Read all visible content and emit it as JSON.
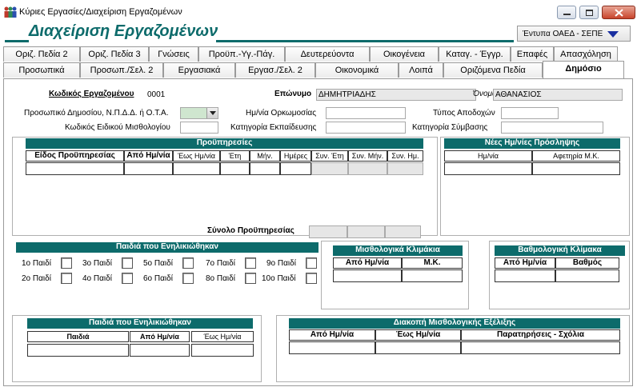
{
  "window": {
    "title": "Κύριες Εργασίες/Διαχείριση Εργαζομένων",
    "heading": "Διαχείριση Εργαζομένων",
    "print_select": "Έντυπα ΟΑΕΔ - ΣΕΠΕ"
  },
  "tabs_row1": [
    "Οριζ. Πεδία 2",
    "Οριζ. Πεδία 3",
    "Γνώσεις",
    "Προϋπ.-Υγ.-Πάγ.",
    "Δευτερεύοντα",
    "Οικογένεια",
    "Καταγ. - Έγγρ.",
    "Επαφές",
    "Απασχόληση"
  ],
  "tabs_row2": [
    "Προσωπικά",
    "Προσωπ./Σελ. 2",
    "Εργασιακά",
    "Εργασ./Σελ. 2",
    "Οικονομικά",
    "Λοιπά",
    "Οριζόμενα Πεδία",
    "Δημόσιο"
  ],
  "employee": {
    "code_label": "Κωδικός Εργαζομένου",
    "code_value": "0001",
    "surname_label": "Επώνυμο",
    "surname_value": "ΔΗΜΗΤΡΙΑΔΗΣ",
    "name_label": "Όνομα",
    "name_value": "ΑΘΑΝΑΣΙΟΣ"
  },
  "fields": {
    "public_staff_label": "Προσωπικό Δημοσίου, Ν.Π.Δ.Δ. ή Ο.Τ.Α.",
    "oath_date_label": "Ημ/νία Ορκωμοσίας",
    "pay_type_label": "Τύπος Αποδοχών",
    "salary_code_label": "Κωδικός Ειδικού Μισθολογίου",
    "education_label": "Κατηγορία Εκπαίδευσης",
    "contract_label": "Κατηγορία Σύμβασης"
  },
  "service": {
    "title": "Προϋπηρεσίες",
    "columns": [
      "Είδος Προϋπηρεσίας",
      "Από Ημ/νία",
      "Έως Ημ/νία",
      "Έτη",
      "Μήν.",
      "Ημέρες",
      "Συν. Έτη",
      "Συν. Μήν.",
      "Συν. Ημ."
    ],
    "total_label": "Σύνολο Προϋπηρεσίας"
  },
  "new_hire": {
    "title": "Νέες Ημ/νίες Πρόσληψης",
    "columns": [
      "Ημ/νία",
      "Αφετηρία Μ.Κ."
    ]
  },
  "children_adults": {
    "title": "Παιδιά που Ενηλικιώθηκαν",
    "items": [
      "1ο Παιδί",
      "2ο Παιδί",
      "3ο Παιδί",
      "4ο Παιδί",
      "5ο Παιδί",
      "6ο Παιδί",
      "7ο Παιδί",
      "8ο Παιδί",
      "9ο Παιδί",
      "10ο Παιδί"
    ]
  },
  "salary_scale": {
    "title": "Μισθολογικά Κλιμάκια",
    "columns": [
      "Από Ημ/νία",
      "Μ.Κ."
    ]
  },
  "grade_scale": {
    "title": "Βαθμολογική Κλίμακα",
    "columns": [
      "Από Ημ/νία",
      "Βαθμός"
    ]
  },
  "children_table": {
    "title": "Παιδιά που Ενηλικιώθηκαν",
    "columns": [
      "Παιδιά",
      "Από Ημ/νία",
      "Έως Ημ/νία"
    ]
  },
  "interruption": {
    "title": "Διακοπή Μισθολογικής Εξέλιξης",
    "columns": [
      "Από Ημ/νία",
      "Έως Ημ/νία",
      "Παρατηρήσεις - Σχόλια"
    ]
  },
  "colors": {
    "accent": "#0d6b6b",
    "combo_fill": "#cfe6cf"
  }
}
